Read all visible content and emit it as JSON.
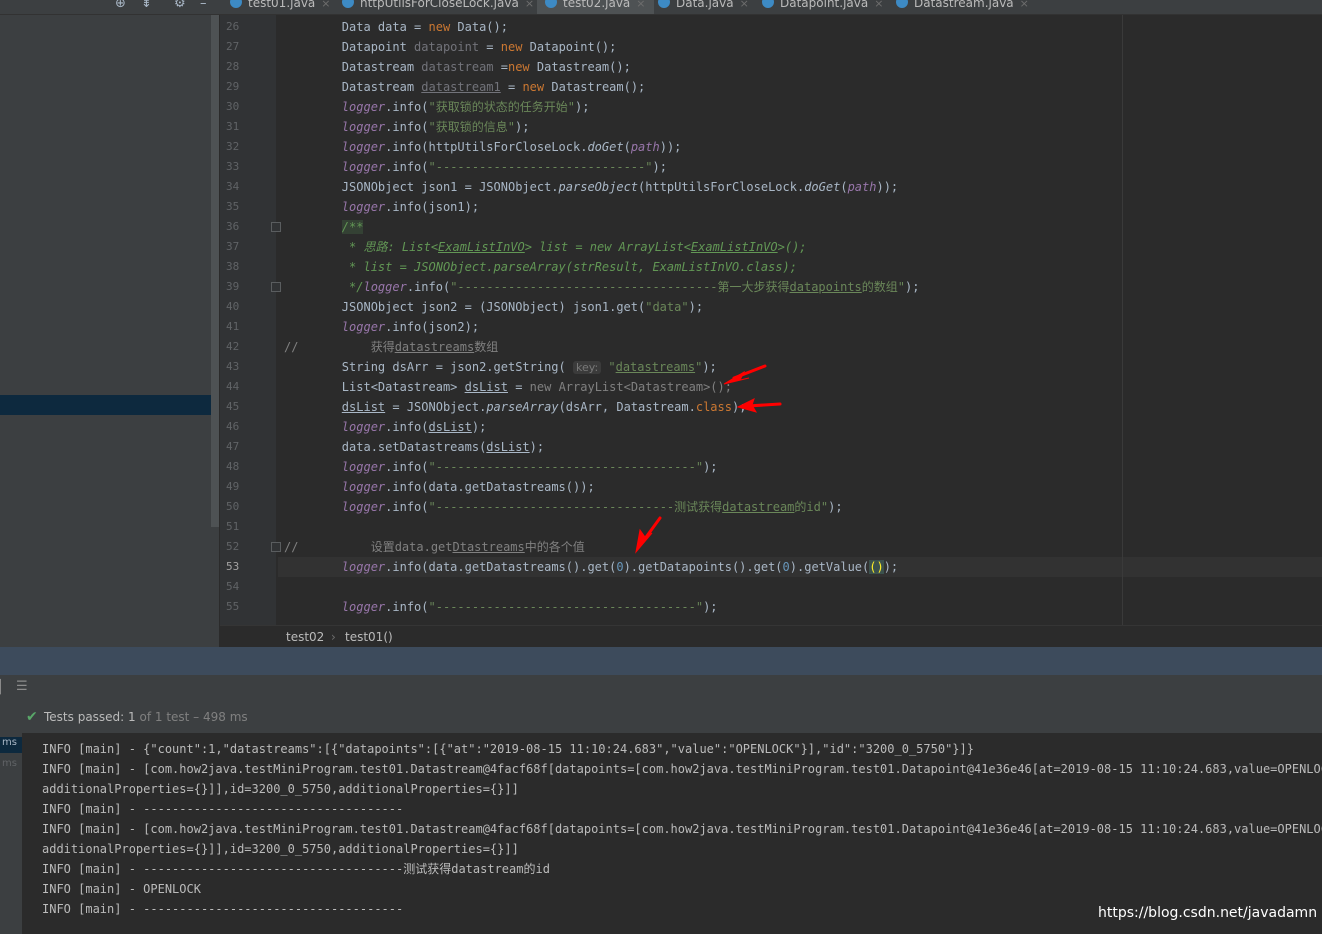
{
  "tabs": [
    {
      "label": "test01.java",
      "active": false
    },
    {
      "label": "httpUtilsForCloseLock.java",
      "active": false
    },
    {
      "label": "test02.java",
      "active": true
    },
    {
      "label": "Data.java",
      "active": false
    },
    {
      "label": "Datapoint.java",
      "active": false
    },
    {
      "label": "Datastream.java",
      "active": false
    }
  ],
  "toolbar": {
    "icons": [
      "crosshair-icon",
      "collapse-icon",
      "gear-icon",
      "minimize-icon"
    ],
    "close_glyph": "×"
  },
  "editor": {
    "current_line": 53,
    "lines": [
      {
        "n": "26",
        "t": ""
      },
      {
        "n": "27",
        "t": ""
      },
      {
        "n": "28",
        "t": ""
      },
      {
        "n": "29",
        "t": ""
      },
      {
        "n": "30",
        "t": ""
      },
      {
        "n": "31",
        "t": ""
      },
      {
        "n": "32",
        "t": ""
      },
      {
        "n": "33",
        "t": ""
      },
      {
        "n": "34",
        "t": ""
      },
      {
        "n": "35",
        "t": ""
      },
      {
        "n": "36",
        "t": ""
      },
      {
        "n": "37",
        "t": ""
      },
      {
        "n": "38",
        "t": ""
      },
      {
        "n": "39",
        "t": ""
      },
      {
        "n": "40",
        "t": ""
      },
      {
        "n": "41",
        "t": ""
      },
      {
        "n": "42",
        "t": ""
      },
      {
        "n": "43",
        "t": ""
      },
      {
        "n": "44",
        "t": ""
      },
      {
        "n": "45",
        "t": ""
      },
      {
        "n": "46",
        "t": ""
      },
      {
        "n": "47",
        "t": ""
      },
      {
        "n": "48",
        "t": ""
      },
      {
        "n": "49",
        "t": ""
      },
      {
        "n": "50",
        "t": ""
      },
      {
        "n": "51",
        "t": ""
      },
      {
        "n": "52",
        "t": ""
      },
      {
        "n": "53",
        "t": ""
      },
      {
        "n": "54",
        "t": ""
      },
      {
        "n": "55",
        "t": ""
      }
    ],
    "code": {
      "c26": [
        "        Data data = ",
        "new",
        " Data();"
      ],
      "c27": [
        "        Datapoint ",
        "datapoint",
        " = ",
        "new",
        " Datapoint();"
      ],
      "c28": [
        "        Datastream ",
        "datastream",
        " =",
        "new",
        " Datastream();"
      ],
      "c29": [
        "        Datastream ",
        "datastream1",
        " = ",
        "new",
        " Datastream();"
      ],
      "c30": [
        "        ",
        "logger",
        ".info(",
        "\"获取锁的状态的任务开始\"",
        ");"
      ],
      "c31": [
        "        ",
        "logger",
        ".info(",
        "\"获取锁的信息\"",
        ");"
      ],
      "c32": [
        "        ",
        "logger",
        ".info(httpUtilsForCloseLock.",
        "doGet",
        "(",
        "path",
        "));"
      ],
      "c33": [
        "        ",
        "logger",
        ".info(",
        "\"-----------------------------\"",
        ");"
      ],
      "c34": [
        "        JSONObject json1 = JSONObject.",
        "parseObject",
        "(httpUtilsForCloseLock.",
        "doGet",
        "(",
        "path",
        "));"
      ],
      "c35": [
        "        ",
        "logger",
        ".info(json1);"
      ],
      "c36": [
        "        ",
        "/**"
      ],
      "c37": [
        "         * 思路: List<",
        "ExamListInVO",
        "> list = new ArrayList<",
        "ExamListInVO",
        ">();"
      ],
      "c38": [
        "         * list = JSONObject.parseArray(strResult, ExamListInVO.class);"
      ],
      "c39": [
        "         */",
        "logger",
        ".info(",
        "\"------------------------------------第一大步获得",
        "datapoints",
        "的数组\"",
        ");"
      ],
      "c40": [
        "        JSONObject json2 = (JSONObject) json1.get(",
        "\"data\"",
        ");"
      ],
      "c41": [
        "        ",
        "logger",
        ".info(json2);"
      ],
      "c42": [
        "//          获得",
        "datastreams",
        "数组"
      ],
      "c43": [
        "        String dsArr = json2.getString( ",
        "key:",
        " \"",
        "datastreams",
        "\"",
        ");"
      ],
      "c44": [
        "        List<Datastream> ",
        "dsList",
        " = ",
        "new ArrayList<Datastream>",
        "();"
      ],
      "c45": [
        "        ",
        "dsList",
        " = JSONObject.",
        "parseArray",
        "(dsArr, Datastream.",
        "class",
        ");"
      ],
      "c46": [
        "        ",
        "logger",
        ".info(",
        "dsList",
        ");"
      ],
      "c47": [
        "        data.setDatastreams(",
        "dsList",
        ");"
      ],
      "c48": [
        "        ",
        "logger",
        ".info(",
        "\"------------------------------------\"",
        ");"
      ],
      "c49": [
        "        ",
        "logger",
        ".info(data.getDatastreams());"
      ],
      "c50": [
        "        ",
        "logger",
        ".info(",
        "\"---------------------------------测试获得",
        "datastream",
        "的id\"",
        ");"
      ],
      "c52": [
        "//          设置data.get",
        "Dtastreams",
        "中的各个值"
      ],
      "c53": [
        "        ",
        "logger",
        ".info(data.getDatastreams().get(",
        "0",
        ").getDatapoints().get(",
        "0",
        ").getValue(",
        "()",
        ");"
      ],
      "c55": [
        "        ",
        "logger",
        ".info(",
        "\"------------------------------------\"",
        ");"
      ]
    }
  },
  "breadcrumb": {
    "items": [
      "test02",
      "test01()"
    ],
    "separator": "›"
  },
  "run": {
    "status_prefix": "Tests passed: ",
    "passed": "1",
    "suffix": " of 1 test – 498 ms",
    "left_labels": [
      "ms",
      "ms"
    ]
  },
  "console": {
    "lines": [
      "INFO [main] - {\"count\":1,\"datastreams\":[{\"datapoints\":[{\"at\":\"2019-08-15 11:10:24.683\",\"value\":\"OPENLOCK\"}],\"id\":\"3200_0_5750\"}]}",
      "INFO [main] - [com.how2java.testMiniProgram.test01.Datastream@4facf68f[datapoints=[com.how2java.testMiniProgram.test01.Datapoint@41e36e46[at=2019-08-15 11:10:24.683,value=OPENLOCK,",
      "additionalProperties={}]],id=3200_0_5750,additionalProperties={}]]",
      "INFO [main] - ------------------------------------",
      "INFO [main] - [com.how2java.testMiniProgram.test01.Datastream@4facf68f[datapoints=[com.how2java.testMiniProgram.test01.Datapoint@41e36e46[at=2019-08-15 11:10:24.683,value=OPENLOCK,",
      "additionalProperties={}]],id=3200_0_5750,additionalProperties={}]]",
      "INFO [main] - ------------------------------------测试获得datastream的id",
      "INFO [main] - OPENLOCK",
      "INFO [main] - ------------------------------------"
    ]
  },
  "watermark": "https://blog.csdn.net/javadamn",
  "colors": {
    "annotation_arrow": "#ff0000",
    "accent": "#4a88c7",
    "passed_green": "#59a869"
  }
}
